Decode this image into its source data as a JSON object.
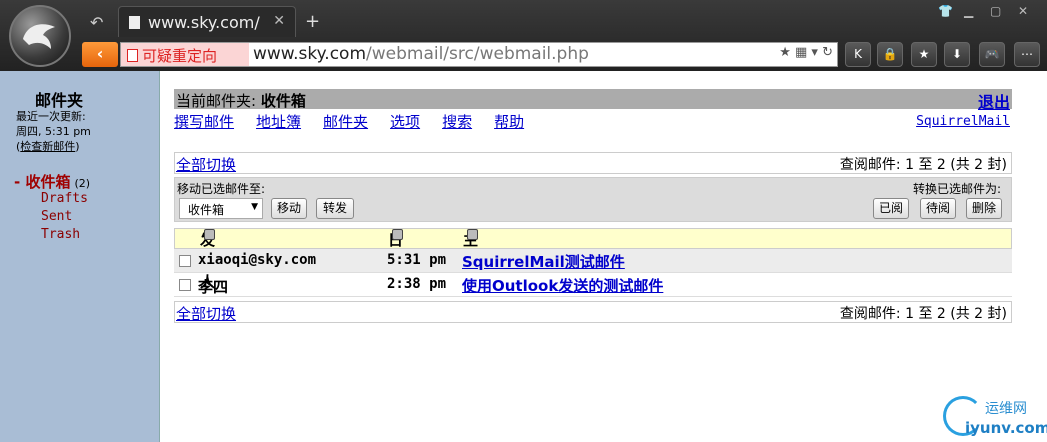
{
  "browser": {
    "tab_title": "www.sky.com/",
    "redirect_label": "可疑重定向",
    "url_host": "www.sky.com",
    "url_path": "/webmail/src/webmail.php"
  },
  "sidebar": {
    "title": "邮件夹",
    "last_update_label": "最近一次更新:",
    "last_update_time": "周四, 5:31 pm",
    "check_mail": "检查新邮件",
    "inbox": {
      "label": "收件箱",
      "count": "(2)"
    },
    "folders": [
      "Drafts",
      "Sent",
      "Trash"
    ]
  },
  "header": {
    "current_folder_label": "当前邮件夹:",
    "current_folder": "收件箱",
    "logout": "退出",
    "nav": [
      "撰写邮件",
      "地址簿",
      "邮件夹",
      "选项",
      "搜索",
      "帮助"
    ],
    "brand": "SquirrelMail"
  },
  "pager": {
    "toggle_all": "全部切换",
    "info": "查阅邮件: 1 至 2 (共 2 封)"
  },
  "actions": {
    "move_label": "移动已选邮件至:",
    "convert_label": "转换已选邮件为:",
    "move_target": "收件箱",
    "move_btn": "移动",
    "forward_btn": "转发",
    "read_btn": "已阅",
    "unread_btn": "待阅",
    "delete_btn": "删除"
  },
  "table": {
    "col_from": "发件人",
    "col_date": "日期",
    "col_subject": "主题",
    "rows": [
      {
        "from": "xiaoqi@sky.com",
        "date": "5:31 pm",
        "subject": "SquirrelMail测试邮件"
      },
      {
        "from": "李四",
        "date": "2:38 pm",
        "subject": "使用Outlook发送的测试邮件"
      }
    ]
  },
  "watermark": {
    "cn": "运维网",
    "en": "iyunv.com"
  }
}
